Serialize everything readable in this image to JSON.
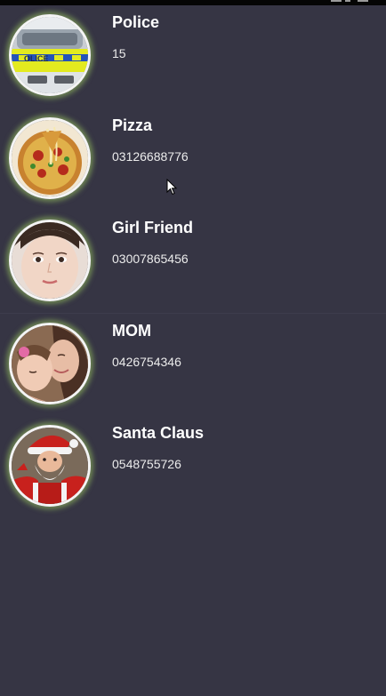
{
  "contacts": [
    {
      "name": "Police",
      "number": "15",
      "avatar": "police-car-photo"
    },
    {
      "name": "Pizza",
      "number": "03126688776",
      "avatar": "pizza-photo"
    },
    {
      "name": "Girl Friend",
      "number": "03007865456",
      "avatar": "woman-face-photo"
    },
    {
      "name": "MOM",
      "number": "0426754346",
      "avatar": "mother-child-photo"
    },
    {
      "name": "Santa Claus",
      "number": "0548755726",
      "avatar": "santa-photo"
    }
  ],
  "theme": {
    "background": "#363544",
    "avatar_glow": "#9ecc60",
    "avatar_border": "#f4f4f4",
    "text": "#ffffff"
  }
}
